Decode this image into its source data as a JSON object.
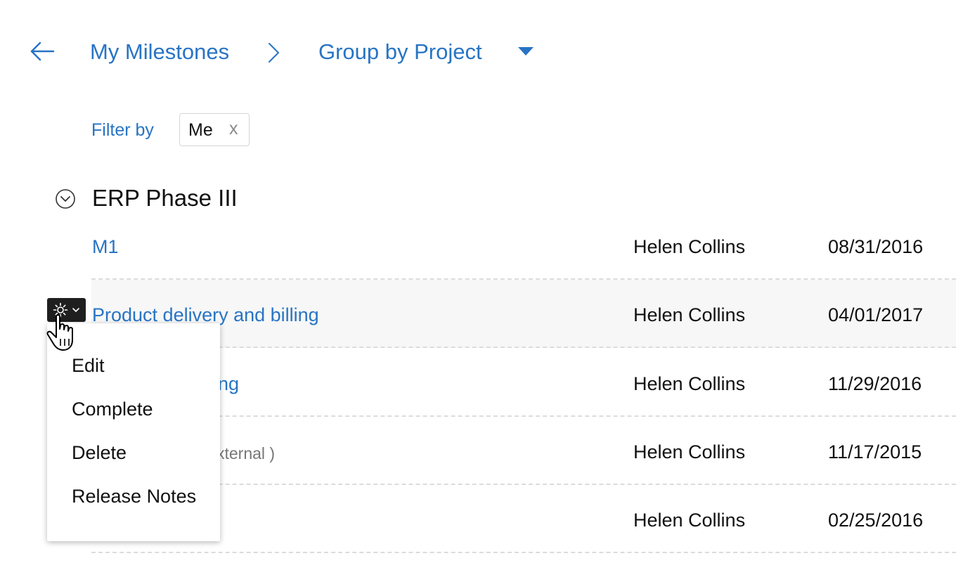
{
  "header": {
    "breadcrumb_root": "My Milestones",
    "group_by_label": "Group by Project"
  },
  "filter": {
    "label": "Filter by",
    "chip_label": "Me",
    "chip_close": "x"
  },
  "group": {
    "title": "ERP Phase III",
    "rows": [
      {
        "name": "M1",
        "owner": "Helen Collins",
        "date": "08/31/2016"
      },
      {
        "name": "Product delivery and billing",
        "owner": "Helen Collins",
        "date": "04/01/2017"
      },
      {
        "name": "ing",
        "owner": "Helen Collins",
        "date": "11/29/2016"
      },
      {
        "name": "xternal )",
        "owner": "Helen Collins",
        "date": "11/17/2015"
      },
      {
        "name": "",
        "owner": "Helen Collins",
        "date": "02/25/2016"
      }
    ]
  },
  "menu": {
    "items": [
      "Edit",
      "Complete",
      "Delete",
      "Release Notes"
    ]
  },
  "colors": {
    "accent": "#2874c4",
    "text": "#111111",
    "divider": "#dcdcdc",
    "menu_button": "#1f1f1f"
  },
  "icons": [
    "back-arrow-icon",
    "chevron-right-icon",
    "caret-down-icon",
    "collapse-circle-icon",
    "gear-icon",
    "chevron-down-icon",
    "hand-pointer-icon"
  ]
}
